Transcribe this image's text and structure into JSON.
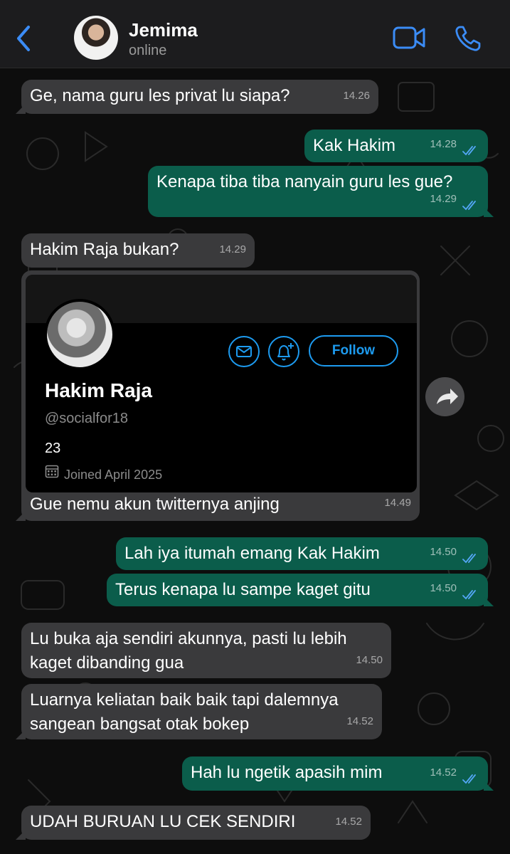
{
  "header": {
    "contact_name": "Jemima",
    "status": "online",
    "accent_color": "#3b8cf6"
  },
  "messages": [
    {
      "dir": "in",
      "text": "Ge, nama guru les privat lu siapa?",
      "time": "14.26"
    },
    {
      "dir": "out",
      "text": "Kak Hakim",
      "time": "14.28",
      "read": true
    },
    {
      "dir": "out",
      "text": "Kenapa tiba tiba nanyain guru les gue?",
      "time": "14.29",
      "read": true
    },
    {
      "dir": "in",
      "text": "Hakim Raja bukan?",
      "time": "14.29"
    },
    {
      "dir": "in",
      "text": "Gue nemu akun twitternya anjing",
      "time": "14.49"
    },
    {
      "dir": "out",
      "text": "Lah iya itumah emang Kak Hakim",
      "time": "14.50",
      "read": true
    },
    {
      "dir": "out",
      "text": "Terus kenapa lu sampe kaget gitu",
      "time": "14.50",
      "read": true
    },
    {
      "dir": "in",
      "lines": [
        "Lu buka aja sendiri akunnya, pasti lu lebih",
        "kaget dibanding gua"
      ],
      "time": "14.50"
    },
    {
      "dir": "in",
      "lines": [
        "Luarnya keliatan baik baik tapi dalemnya",
        "sangean bangsat otak bokep"
      ],
      "time": "14.52"
    },
    {
      "dir": "out",
      "text": "Hah lu ngetik apasih mim",
      "time": "14.52",
      "read": true
    },
    {
      "dir": "in",
      "text": "UDAH BURUAN LU CEK SENDIRI",
      "time": "14.52"
    }
  ],
  "twitter_card": {
    "name": "Hakim Raja",
    "handle": "@socialfor18",
    "bio": "23",
    "joined": "Joined April 2025",
    "follow_label": "Follow",
    "accent_color": "#1d9bf0"
  },
  "colors": {
    "incoming_bubble": "#3a3a3c",
    "outgoing_bubble": "#0b5d4b",
    "read_ticks": "#53a6f5"
  }
}
